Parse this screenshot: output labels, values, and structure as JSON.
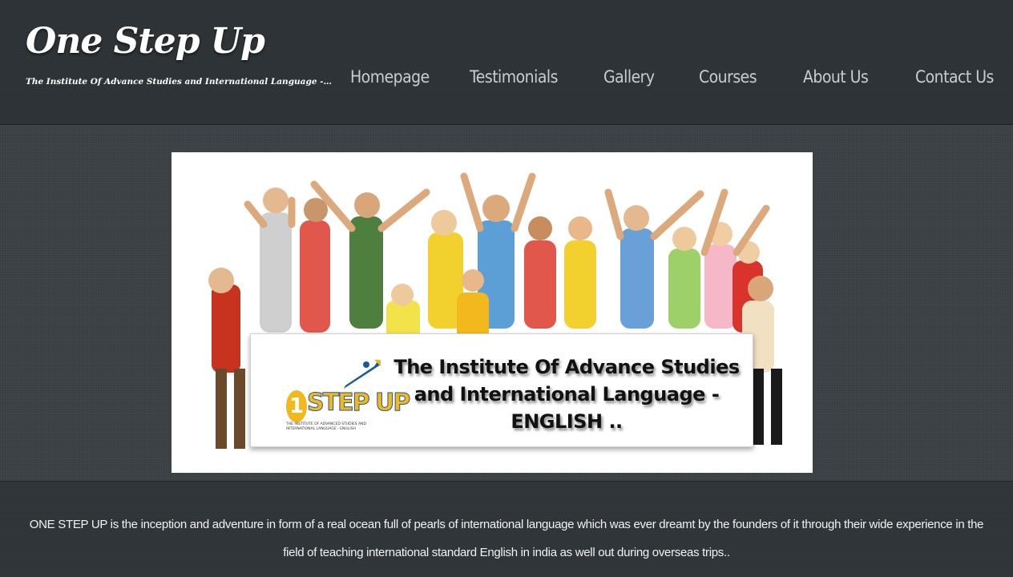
{
  "header": {
    "site_title": "One Step Up",
    "tagline": "The Institute Of Advance Studies and International Language - ENGLISH ..."
  },
  "nav": {
    "items": [
      {
        "label": "Homepage"
      },
      {
        "label": "Testimonials"
      },
      {
        "label": "Gallery"
      },
      {
        "label": "Courses"
      },
      {
        "label": "About Us"
      },
      {
        "label": "Contact Us"
      }
    ]
  },
  "banner": {
    "heading": "The Institute Of Advance Studies and International Language - ENGLISH ..",
    "logo": {
      "number": "1",
      "word": "STEP UP",
      "subtitle": "THE INSTITUTE OF ADVANCED STUDIES AND INTERNATIONAL LANGUAGE - ENGLISH"
    },
    "photo_icon": "group-of-cheering-students-photo"
  },
  "main": {
    "intro": "ONE STEP UP is the inception and adventure in form of a real ocean full of pearls of international language which was ever dreamt by the founders of it through their wide experience in the field of teaching international standard English in india as well out during overseas trips.."
  },
  "colors": {
    "background": "#3b4246",
    "header_band": "#24282b",
    "nav_text": "#c9cdcf",
    "title_text": "#ffffff",
    "logo_yellow": "#f2b81c",
    "logo_blue": "#1a5a9a"
  }
}
